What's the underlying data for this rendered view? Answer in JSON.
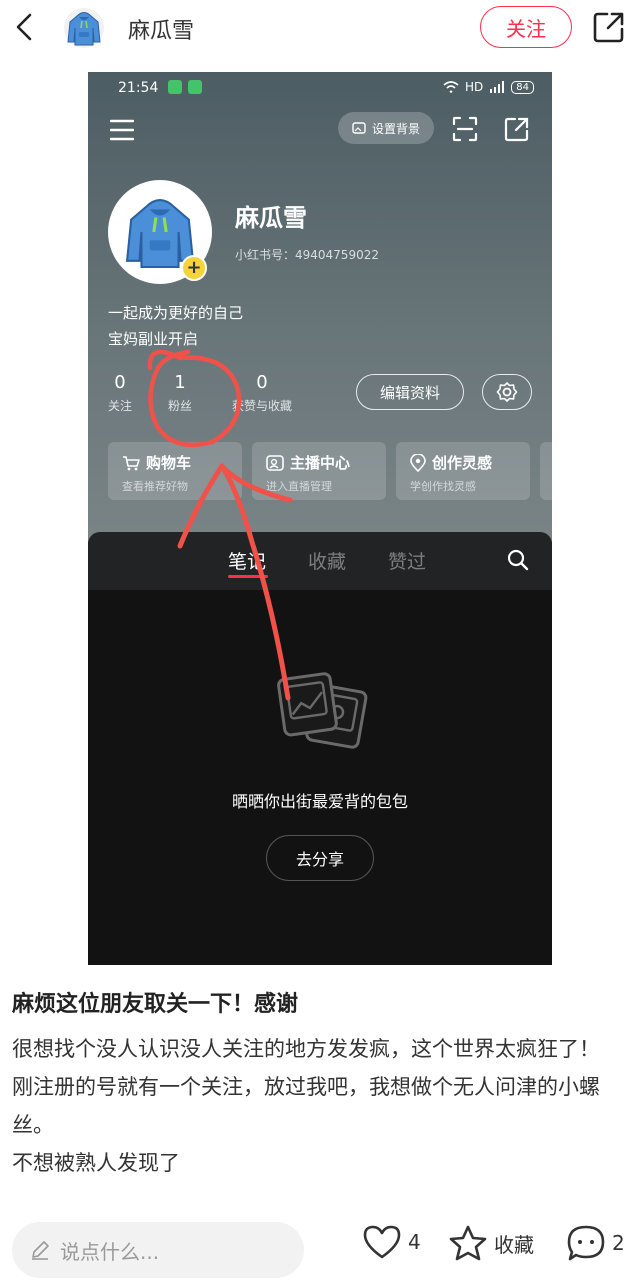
{
  "topbar": {
    "author_name": "麻瓜雪",
    "follow_label": "关注"
  },
  "screenshot": {
    "status_time": "21:54",
    "status_net": "HD",
    "battery": "84",
    "bg_button": "设置背景",
    "nickname": "麻瓜雪",
    "red_id": "小红书号：49404759022",
    "bio_line1": "一起成为更好的自己",
    "bio_line2": "宝妈副业开启",
    "stats": [
      {
        "num": "0",
        "label": "关注"
      },
      {
        "num": "1",
        "label": "粉丝"
      },
      {
        "num": "0",
        "label": "获赞与收藏"
      }
    ],
    "edit_profile": "编辑资料",
    "cards": [
      {
        "title": "购物车",
        "sub": "查看推荐好物"
      },
      {
        "title": "主播中心",
        "sub": "进入直播管理"
      },
      {
        "title": "创作灵感",
        "sub": "学创作找灵感"
      }
    ],
    "tabs": [
      "笔记",
      "收藏",
      "赞过"
    ],
    "empty_text": "晒晒你出街最爱背的包包",
    "share_button": "去分享"
  },
  "post": {
    "title": "麻烦这位朋友取关一下！感谢",
    "body": "很想找个没人认识没人关注的地方发发疯，这个世界太疯狂了！\n刚注册的号就有一个关注，放过我吧，我想做个无人问津的小螺丝。\n不想被熟人发现了"
  },
  "bottombar": {
    "comment_placeholder": "说点什么...",
    "like_count": "4",
    "collect_label": "收藏",
    "comment_count": "2"
  },
  "colors": {
    "accent": "#ff2e4d",
    "annotation": "#f0524a"
  }
}
